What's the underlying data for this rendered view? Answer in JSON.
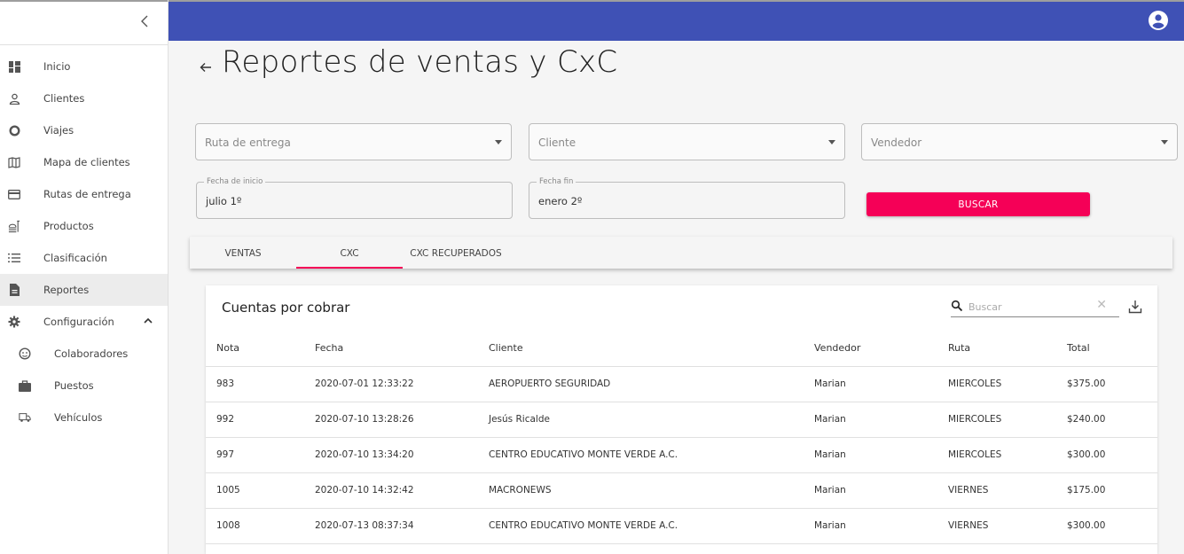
{
  "sidebar": {
    "items": [
      {
        "label": "Inicio",
        "icon": "dashboard-icon"
      },
      {
        "label": "Clientes",
        "icon": "person-icon"
      },
      {
        "label": "Viajes",
        "icon": "circle-icon"
      },
      {
        "label": "Mapa de clientes",
        "icon": "map-icon"
      },
      {
        "label": "Rutas de entrega",
        "icon": "card-icon"
      },
      {
        "label": "Productos",
        "icon": "food-icon"
      },
      {
        "label": "Clasificación",
        "icon": "list-icon"
      },
      {
        "label": "Reportes",
        "icon": "document-icon"
      },
      {
        "label": "Configuración",
        "icon": "gear-icon"
      },
      {
        "label": "Colaboradores",
        "icon": "face-icon"
      },
      {
        "label": "Puestos",
        "icon": "briefcase-icon"
      },
      {
        "label": "Vehículos",
        "icon": "truck-icon"
      }
    ]
  },
  "page": {
    "title": "Reportes de ventas y CxC"
  },
  "filters": {
    "ruta": "Ruta de entrega",
    "cliente": "Cliente",
    "vendedor": "Vendedor",
    "fecha_inicio_label": "Fecha de inicio",
    "fecha_inicio": "julio 1º",
    "fecha_fin_label": "Fecha fin",
    "fecha_fin": "enero 2º",
    "buscar": "BUSCAR"
  },
  "tabs": [
    "VENTAS",
    "CXC",
    "CXC RECUPERADOS"
  ],
  "table": {
    "title": "Cuentas por cobrar",
    "search_placeholder": "Buscar",
    "headers": [
      "Nota",
      "Fecha",
      "Cliente",
      "Vendedor",
      "Ruta",
      "Total"
    ],
    "rows": [
      [
        "983",
        "2020-07-01 12:33:22",
        "AEROPUERTO SEGURIDAD",
        "Marian",
        "MIERCOLES",
        "$375.00"
      ],
      [
        "992",
        "2020-07-10 13:28:26",
        "Jesús Ricalde",
        "Marian",
        "MIERCOLES",
        "$240.00"
      ],
      [
        "997",
        "2020-07-10 13:34:20",
        "CENTRO EDUCATIVO MONTE VERDE A.C.",
        "Marian",
        "MIERCOLES",
        "$300.00"
      ],
      [
        "1005",
        "2020-07-10 14:32:42",
        "MACRONEWS",
        "Marian",
        "VIERNES",
        "$175.00"
      ],
      [
        "1008",
        "2020-07-13 08:37:34",
        "CENTRO EDUCATIVO MONTE VERDE A.C.",
        "Marian",
        "VIERNES",
        "$300.00"
      ]
    ]
  },
  "colors": {
    "appbar": "#3f51b5",
    "accent": "#f50057"
  }
}
